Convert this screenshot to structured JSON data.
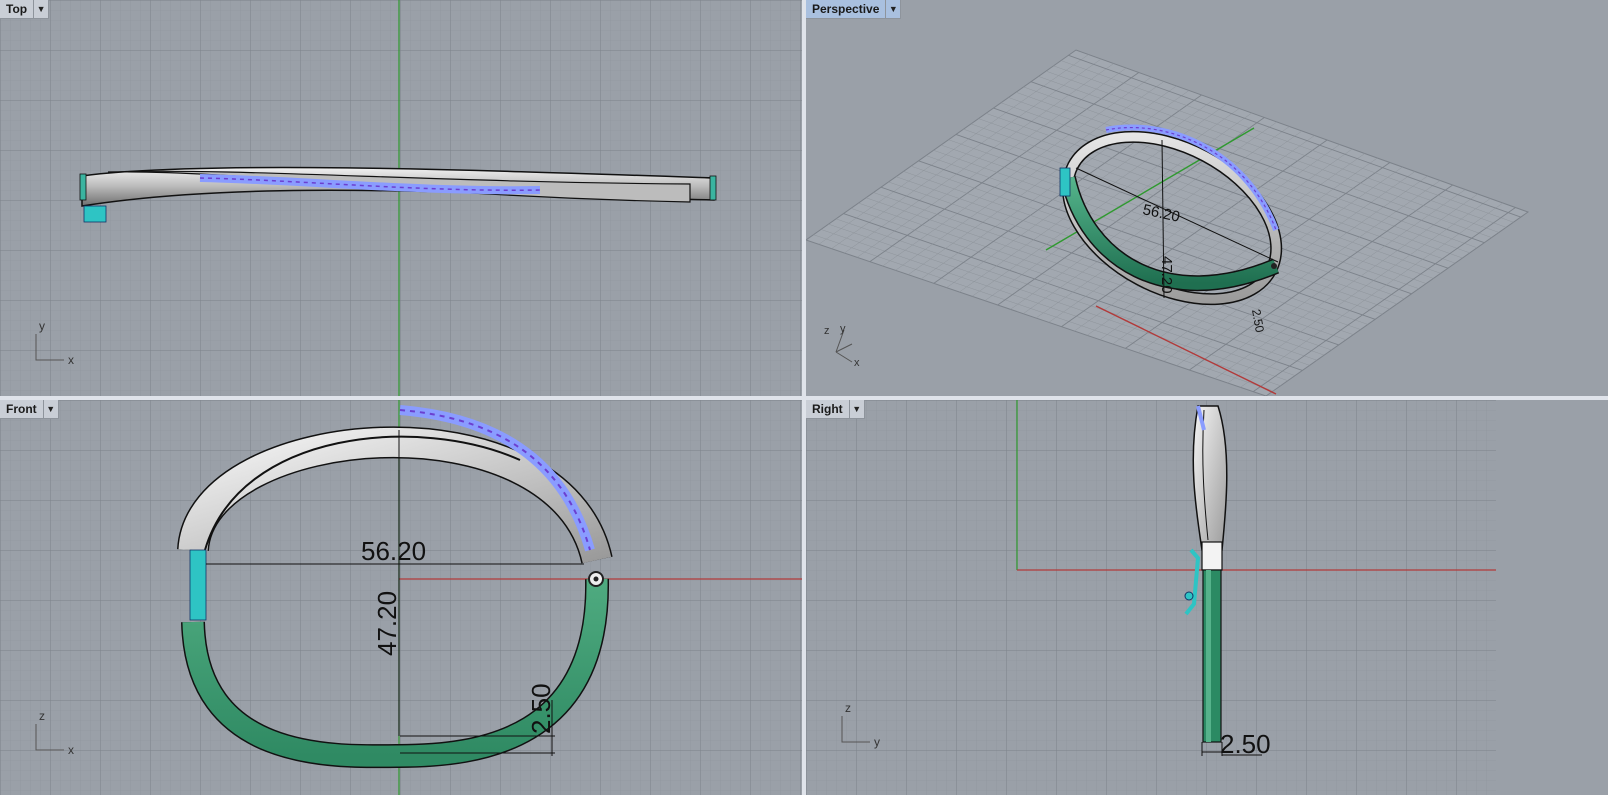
{
  "viewports": {
    "top": {
      "label": "Top",
      "axes": {
        "a": "y",
        "b": "x"
      }
    },
    "persp": {
      "label": "Perspective",
      "axes": {
        "a": "z",
        "b": "y",
        "c": "x"
      }
    },
    "front": {
      "label": "Front",
      "axes": {
        "a": "z",
        "b": "x"
      }
    },
    "right": {
      "label": "Right",
      "axes": {
        "a": "z",
        "b": "y"
      }
    }
  },
  "dimensions": {
    "width": "56.20",
    "height": "47.20",
    "thickness": "2.50"
  },
  "colors": {
    "viewport_bg": "#9aa0a8",
    "grid_minor": "#8e949b",
    "grid_major": "#7a8088",
    "axis_x": "#b23a3a",
    "axis_y": "#2f9a2f",
    "metal": "#d8d8d8",
    "gem": "#8a9cff",
    "green_part": "#3e9a74",
    "clasp": "#2ec4c4",
    "active_tab": "#a9c0df"
  },
  "icons": {
    "dropdown": "chevron-down-icon"
  }
}
